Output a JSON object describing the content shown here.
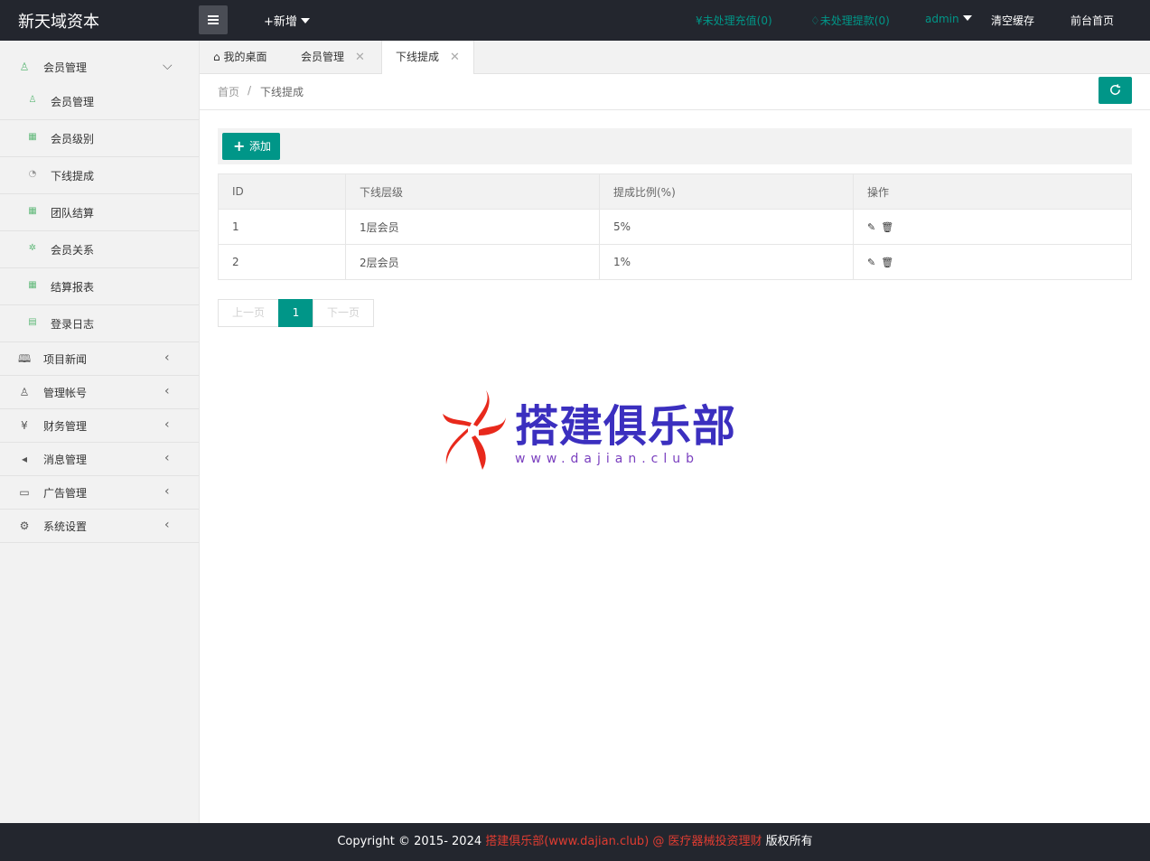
{
  "header": {
    "logo": "新天域资本",
    "new_label": "+新增",
    "recharge_label": "未处理充值(0)",
    "withdraw_label": "未处理提款(0)",
    "user": "admin",
    "clear_cache": "清空缓存",
    "front_home": "前台首页"
  },
  "sidebar": {
    "groups": [
      {
        "label": "会员管理",
        "icon": "user-icon",
        "expanded": true,
        "items": [
          {
            "label": "会员管理",
            "icon": "user-icon"
          },
          {
            "label": "会员级别",
            "icon": "apps-icon"
          },
          {
            "label": "下线提成",
            "icon": "gauge-icon"
          },
          {
            "label": "团队结算",
            "icon": "apps-icon"
          },
          {
            "label": "会员关系",
            "icon": "tree-icon"
          },
          {
            "label": "结算报表",
            "icon": "apps-icon"
          },
          {
            "label": "登录日志",
            "icon": "calendar-icon"
          }
        ]
      },
      {
        "label": "项目新闻",
        "icon": "book-icon"
      },
      {
        "label": "管理帐号",
        "icon": "users-icon"
      },
      {
        "label": "财务管理",
        "icon": "yen-icon"
      },
      {
        "label": "消息管理",
        "icon": "speaker-icon"
      },
      {
        "label": "广告管理",
        "icon": "picture-icon"
      },
      {
        "label": "系统设置",
        "icon": "gear-icon"
      }
    ]
  },
  "tabs": [
    {
      "label": "我的桌面",
      "icon": "home-icon"
    },
    {
      "label": "会员管理"
    },
    {
      "label": "下线提成",
      "active": true
    }
  ],
  "breadcrumb": {
    "home": "首页",
    "sep": "/",
    "current": "下线提成"
  },
  "toolbar": {
    "add_label": "添加"
  },
  "table": {
    "headers": [
      "ID",
      "下线层级",
      "提成比例(%)",
      "操作"
    ],
    "rows": [
      {
        "id": "1",
        "level": "1层会员",
        "ratio": "5%"
      },
      {
        "id": "2",
        "level": "2层会员",
        "ratio": "1%"
      }
    ]
  },
  "pager": {
    "prev": "上一页",
    "current": "1",
    "next": "下一页"
  },
  "watermark": {
    "title": "搭建俱乐部",
    "url": "www.dajian.club"
  },
  "footer": {
    "prefix": "Copyright © 2015- 2024 ",
    "highlight": "搭建俱乐部(www.dajian.club) @ 医疗器械投资理财",
    "suffix": " 版权所有"
  },
  "colors": {
    "accent": "#009688",
    "header_bg": "#23262e",
    "highlight": "#e03c31"
  }
}
